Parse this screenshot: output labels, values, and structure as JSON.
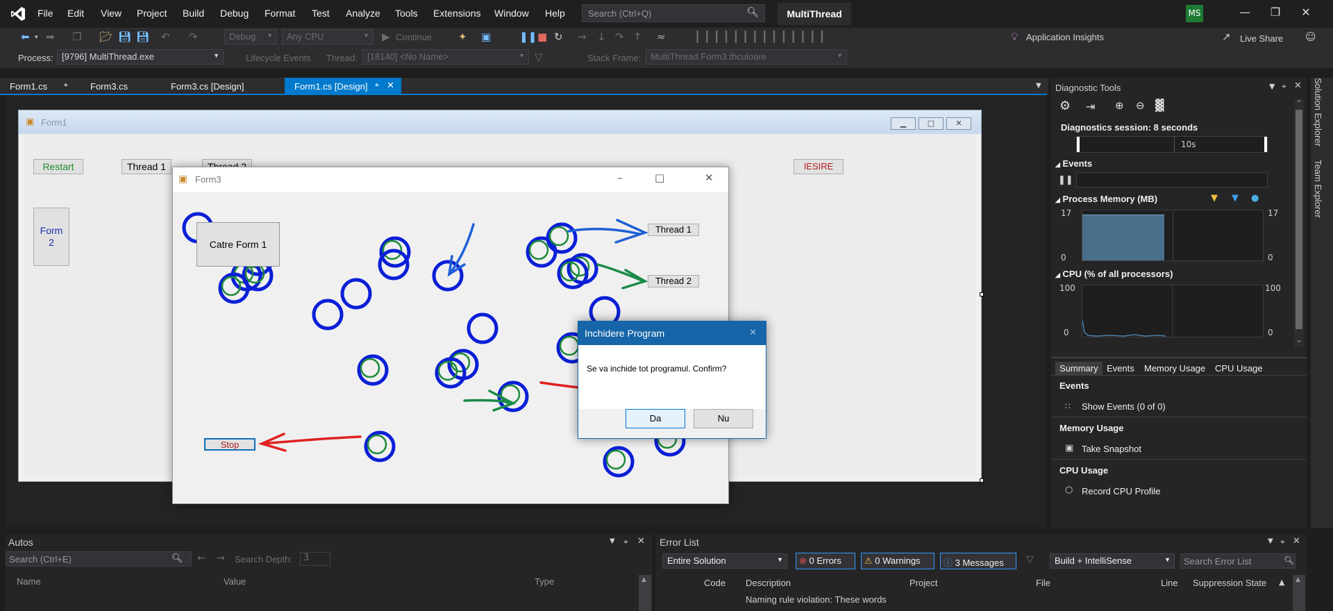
{
  "menu": [
    "File",
    "Edit",
    "View",
    "Project",
    "Build",
    "Debug",
    "Format",
    "Test",
    "Analyze",
    "Tools",
    "Extensions",
    "Window",
    "Help"
  ],
  "search": {
    "placeholder": "Search (Ctrl+Q)"
  },
  "app_title": "MultiThread",
  "user_initials": "MS",
  "toolbar": {
    "config": "Debug",
    "platform": "Any CPU",
    "continue_label": "Continue",
    "app_insights": "Application Insights",
    "live_share": "Live Share"
  },
  "debug_location": {
    "process_label": "Process:",
    "process_value": "[9796] MultiThread.exe",
    "lifecycle_label": "Lifecycle Events",
    "thread_label": "Thread:",
    "thread_value": "[18140] <No Name>",
    "stack_label": "Stack Frame:",
    "stack_value": "MultiThread.Form3.thculoare"
  },
  "doc_tabs": [
    "Form1.cs",
    "Form3.cs",
    "Form3.cs [Design]",
    "Form1.cs [Design]"
  ],
  "form1": {
    "title": "Form1",
    "restart": "Restart",
    "thread1": "Thread 1",
    "thread2": "Thread 2",
    "iesire": "IESIRE",
    "form2": "Form\n2"
  },
  "form3": {
    "title": "Form3",
    "catre_form1": "Catre Form 1",
    "thread1": "Thread 1",
    "thread2": "Thread 2",
    "stop": "Stop"
  },
  "dialog": {
    "title": "Inchidere Program",
    "message": "Se va inchide tot programul. Confirm?",
    "yes": "Da",
    "no": "Nu"
  },
  "diagnostics": {
    "title": "Diagnostic Tools",
    "session": "Diagnostics session: 8 seconds",
    "timeline_label": "10s",
    "events_header": "Events",
    "memory_header": "Process Memory (MB)",
    "memory_max": "17",
    "memory_min": "0",
    "cpu_header": "CPU (% of all processors)",
    "cpu_max": "100",
    "cpu_min": "0",
    "tabs": [
      "Summary",
      "Events",
      "Memory Usage",
      "CPU Usage"
    ],
    "summary": {
      "events_h": "Events",
      "show_events": "Show Events (0 of 0)",
      "memory_h": "Memory Usage",
      "take_snapshot": "Take Snapshot",
      "cpu_h": "CPU Usage",
      "record_cpu": "Record CPU Profile"
    }
  },
  "side_tabs": [
    "Solution Explorer",
    "Team Explorer"
  ],
  "autos": {
    "title": "Autos",
    "search_placeholder": "Search (Ctrl+E)",
    "depth_label": "Search Depth:",
    "depth_value": "3",
    "columns": [
      "Name",
      "Value",
      "Type"
    ]
  },
  "error_list": {
    "title": "Error List",
    "scope": "Entire Solution",
    "errors": "0 Errors",
    "warnings": "0 Warnings",
    "messages": "3 Messages",
    "build_filter": "Build + IntelliSense",
    "search_placeholder": "Search Error List",
    "columns": [
      "Code",
      "Description",
      "Project",
      "File",
      "Line",
      "Suppression State"
    ],
    "row_description": "Naming rule violation: These words"
  },
  "colors": {
    "accent": "#007acc",
    "ring_blue": "#0a1fd6",
    "ring_green": "#1e8a3a",
    "arrow_red": "#e02020",
    "arrow_blue": "#1e5fd6",
    "arrow_green": "#1a8a4a"
  }
}
